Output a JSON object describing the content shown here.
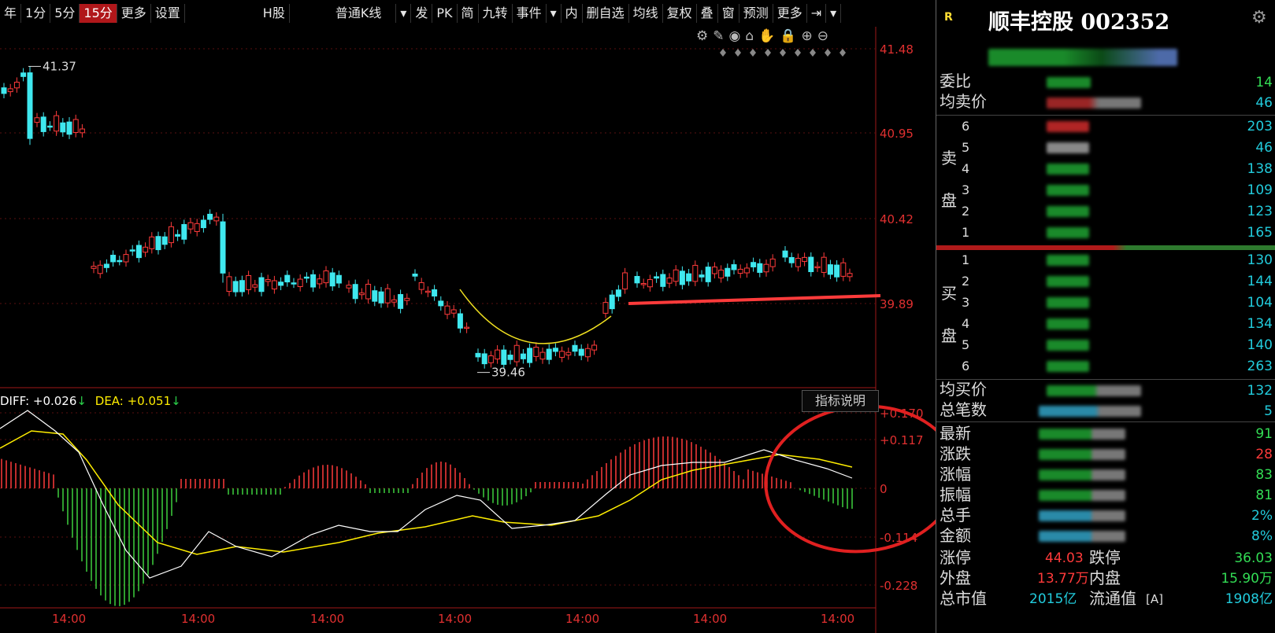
{
  "toolbar": {
    "items": [
      "年",
      "1分",
      "5分",
      "15分",
      "更多",
      "设置",
      "H股",
      "普通K线",
      "▾",
      "发",
      "PK",
      "简",
      "九转",
      "事件",
      "▾",
      "内",
      "删自选",
      "均线",
      "复权",
      "叠",
      "窗",
      "预测",
      "更多",
      "⇥",
      "▾"
    ],
    "active_index": 3
  },
  "tool_icons": [
    "⚙",
    "✎",
    "◉",
    "⌂",
    "✋",
    "🔒",
    "⊕",
    "⊖"
  ],
  "price_axis": [
    "41.48",
    "40.95",
    "40.42",
    "39.89"
  ],
  "macd_axis": [
    "+0.170",
    "+0.117",
    "0",
    "-0.114",
    "-0.228"
  ],
  "annotations": {
    "high": "41.37",
    "low": "39.46"
  },
  "legend": {
    "diff_label": "DIFF: +0.026",
    "diff_arrow": "↓",
    "dea_label": "DEA: +0.051",
    "dea_arrow": "↓",
    "diff_color": "#ffffff",
    "dea_color": "#ffee00"
  },
  "indicator_button": "指标说明",
  "x_ticks": [
    "14:00",
    "14:00",
    "14:00",
    "14:00",
    "14:00",
    "14:00",
    "14:00"
  ],
  "right_panel": {
    "badge": "R",
    "title": "顺丰控股 002352",
    "weibi": "委比",
    "junmai": "均卖价",
    "sell": "卖",
    "buy": "买",
    "pan": "盘",
    "levels": [
      "6",
      "5",
      "4",
      "3",
      "2",
      "1"
    ],
    "sell_tails": [
      "203",
      "46",
      "138",
      "109",
      "123",
      "165"
    ],
    "buy_levels": [
      "1",
      "2",
      "3",
      "4",
      "5",
      "6"
    ],
    "buy_tails": [
      "130",
      "144",
      "104",
      "134",
      "140",
      "263"
    ],
    "top_tails": [
      "14",
      "46"
    ],
    "junmaijia": "均买价",
    "zongbishu": "总笔数",
    "mid_tails": [
      "132",
      "5"
    ],
    "stat_labels": [
      "最新",
      "涨跌",
      "涨幅",
      "振幅",
      "总手",
      "金额"
    ],
    "stat_tails": [
      "91",
      "28",
      "83",
      "81",
      "2%",
      "8%"
    ],
    "zhangting_label": "涨停",
    "zhangting_value": "44.03",
    "dieting_label": "跌停",
    "dieting_value": "36.03",
    "waipan_label": "外盘",
    "waipan_value": "13.77万",
    "neipan_label": "内盘",
    "neipan_value": "15.90万",
    "zongshizhi_label": "总市值",
    "zongshizhi_value": "2015亿",
    "liutong_label": "流通值",
    "liutong_tag": "[A]",
    "liutong_value": "1908亿"
  },
  "chart_data": {
    "type": "candlestick",
    "y_ticks": [
      41.48,
      40.95,
      40.42,
      39.89
    ],
    "macd_ticks": [
      0.17,
      0.117,
      0,
      -0.114,
      -0.228
    ],
    "high_label": 41.37,
    "low_label": 39.46,
    "diff": 0.026,
    "dea": 0.051
  }
}
